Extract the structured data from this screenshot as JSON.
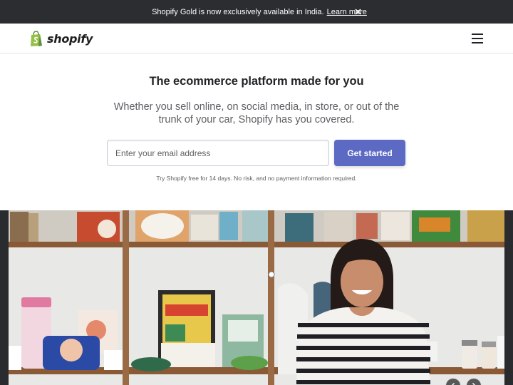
{
  "announcement": {
    "message": "Shopify Gold is now exclusively available in India.",
    "link_label": "Learn more",
    "close_icon": "close-icon"
  },
  "nav": {
    "logo_text": "shopify",
    "logo_icon": "shopping-bag-icon",
    "menu_icon": "hamburger-menu-icon"
  },
  "hero": {
    "title": "The ecommerce platform made for you",
    "subtitle": "Whether you sell online, on social media, in store, or out of the trunk of your car, Shopify has you covered.",
    "email_placeholder": "Enter your email address",
    "cta_label": "Get started",
    "fine_print": "Try Shopify free for 14 days. No risk, and no payment information required."
  },
  "carousel": {
    "prev_icon": "chevron-left-icon",
    "next_icon": "chevron-right-icon"
  },
  "colors": {
    "announce_bg": "#2b2d31",
    "cta_bg": "#5c6ac4",
    "logo_green": "#95bf47",
    "text_dark": "#212326",
    "text_muted": "#5c5f62"
  }
}
